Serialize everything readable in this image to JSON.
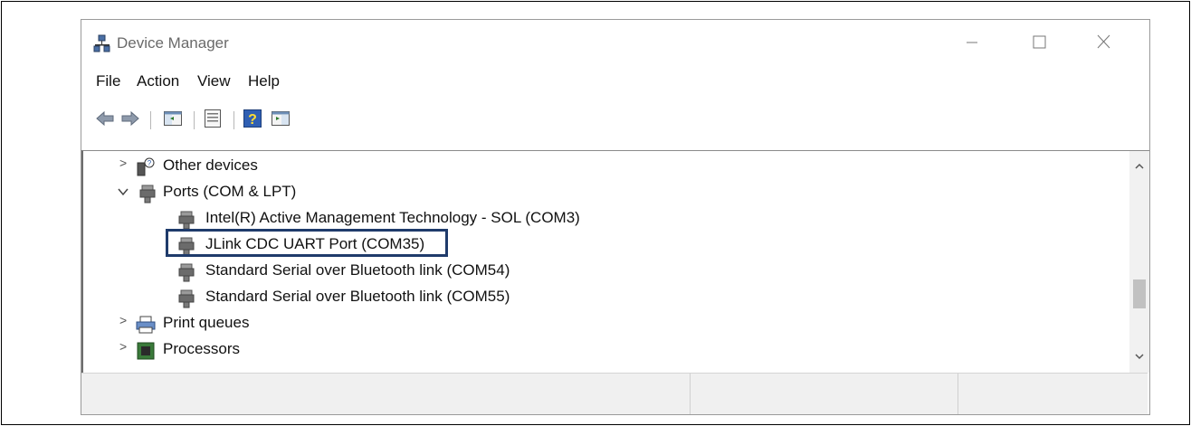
{
  "window": {
    "title": "Device Manager"
  },
  "menu": [
    "File",
    "Action",
    "View",
    "Help"
  ],
  "toolbar": {
    "buttons": [
      "back-arrow-icon",
      "forward-arrow-icon",
      "show-hide-console-tree-icon",
      "properties-icon",
      "help-icon",
      "show-action-pane-icon"
    ]
  },
  "tree": {
    "other_devices": "Other devices",
    "ports": "Ports (COM & LPT)",
    "port_items": [
      "Intel(R) Active Management Technology - SOL (COM3)",
      "JLink CDC UART Port (COM35)",
      "Standard Serial over Bluetooth link (COM54)",
      "Standard Serial over Bluetooth link (COM55)"
    ],
    "print_queues": "Print queues",
    "processors": "Processors"
  },
  "colors": {
    "highlight_border": "#1f3b6b",
    "status_bar": "#f0f0f0"
  }
}
